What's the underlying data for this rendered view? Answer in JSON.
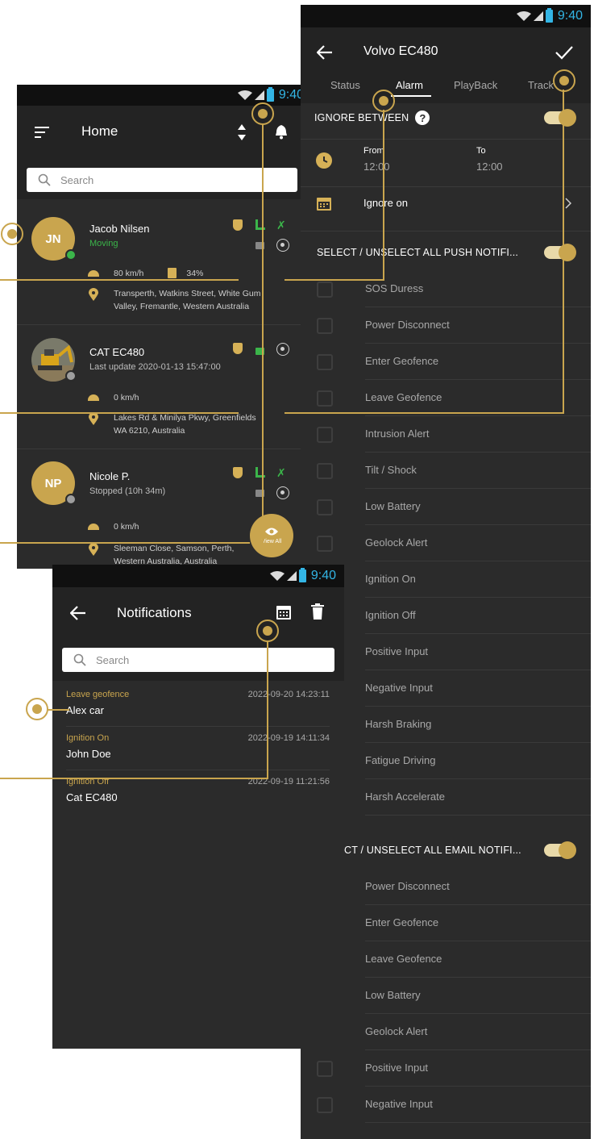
{
  "colors": {
    "accent": "#c9a54e",
    "online": "#3bb54a",
    "offline": "#9e9e9e",
    "status_clock": "#33b5e5"
  },
  "status_bar": {
    "time": "9:40"
  },
  "home": {
    "title": "Home",
    "search_placeholder": "Search",
    "devices": [
      {
        "initials": "JN",
        "name": "Jacob Nilsen",
        "status": "Moving",
        "speed": "80 km/h",
        "fuel": "34%",
        "address": "Transperth, Watkins Street, White Gum Valley, Fremantle, Western Australia",
        "address_line1": "Transperth, Watkins Street, White Gum",
        "address_line2": "Valley, Fremantle, Western Australia",
        "online": "online"
      },
      {
        "initials": "",
        "name": "CAT EC480",
        "status": "Last update 2020-01-13 15:47:00",
        "speed": "0 km/h",
        "address_line1": "Lakes Rd & Minilya Pkwy, Greenfields",
        "address_line2": "WA 6210, Australia",
        "online": "offline"
      },
      {
        "initials": "NP",
        "name": "Nicole P.",
        "status": "Stopped (10h 34m)",
        "speed": "0 km/h",
        "address_line1": "Sleeman Close, Samson, Perth,",
        "address_line2": "Western Australia, Australia",
        "online": "offline"
      }
    ],
    "view_all_label": "View All"
  },
  "alarm": {
    "title": "Volvo EC480",
    "tabs": [
      "Status",
      "Alarm",
      "PlayBack",
      "Track"
    ],
    "ignore_between_label": "IGNORE BETWEEN",
    "from_label": "From",
    "from_value": "12:00",
    "to_label": "To",
    "to_value": "12:00",
    "ignore_on_label": "Ignore on",
    "push_header": "SELECT / UNSELECT ALL PUSH NOTIFI...",
    "push_items": [
      "SOS Duress",
      "Power Disconnect",
      "Enter Geofence",
      "Leave Geofence",
      "Intrusion Alert",
      "Tilt / Shock",
      "Low Battery",
      "Geolock Alert",
      "Ignition On",
      "Ignition Off",
      "Positive Input",
      "Negative Input",
      "Harsh Braking",
      "Fatigue Driving",
      "Harsh Accelerate"
    ],
    "email_header": "CT / UNSELECT ALL EMAIL NOTIFI...",
    "email_items": [
      "Power Disconnect",
      "Enter Geofence",
      "Leave Geofence",
      "Low Battery",
      "Geolock Alert",
      "Positive Input",
      "Negative Input"
    ]
  },
  "notifications": {
    "title": "Notifications",
    "search_placeholder": "Search",
    "items": [
      {
        "type": "Leave geofence",
        "name": "Alex car",
        "time": "2022-09-20  14:23:11"
      },
      {
        "type": "Ignition On",
        "name": "John Doe",
        "time": "2022-09-19 14:11:34"
      },
      {
        "type": "Ignition Off",
        "name": "Cat EC480",
        "time": "2022-09-19 11:21:56"
      }
    ]
  }
}
